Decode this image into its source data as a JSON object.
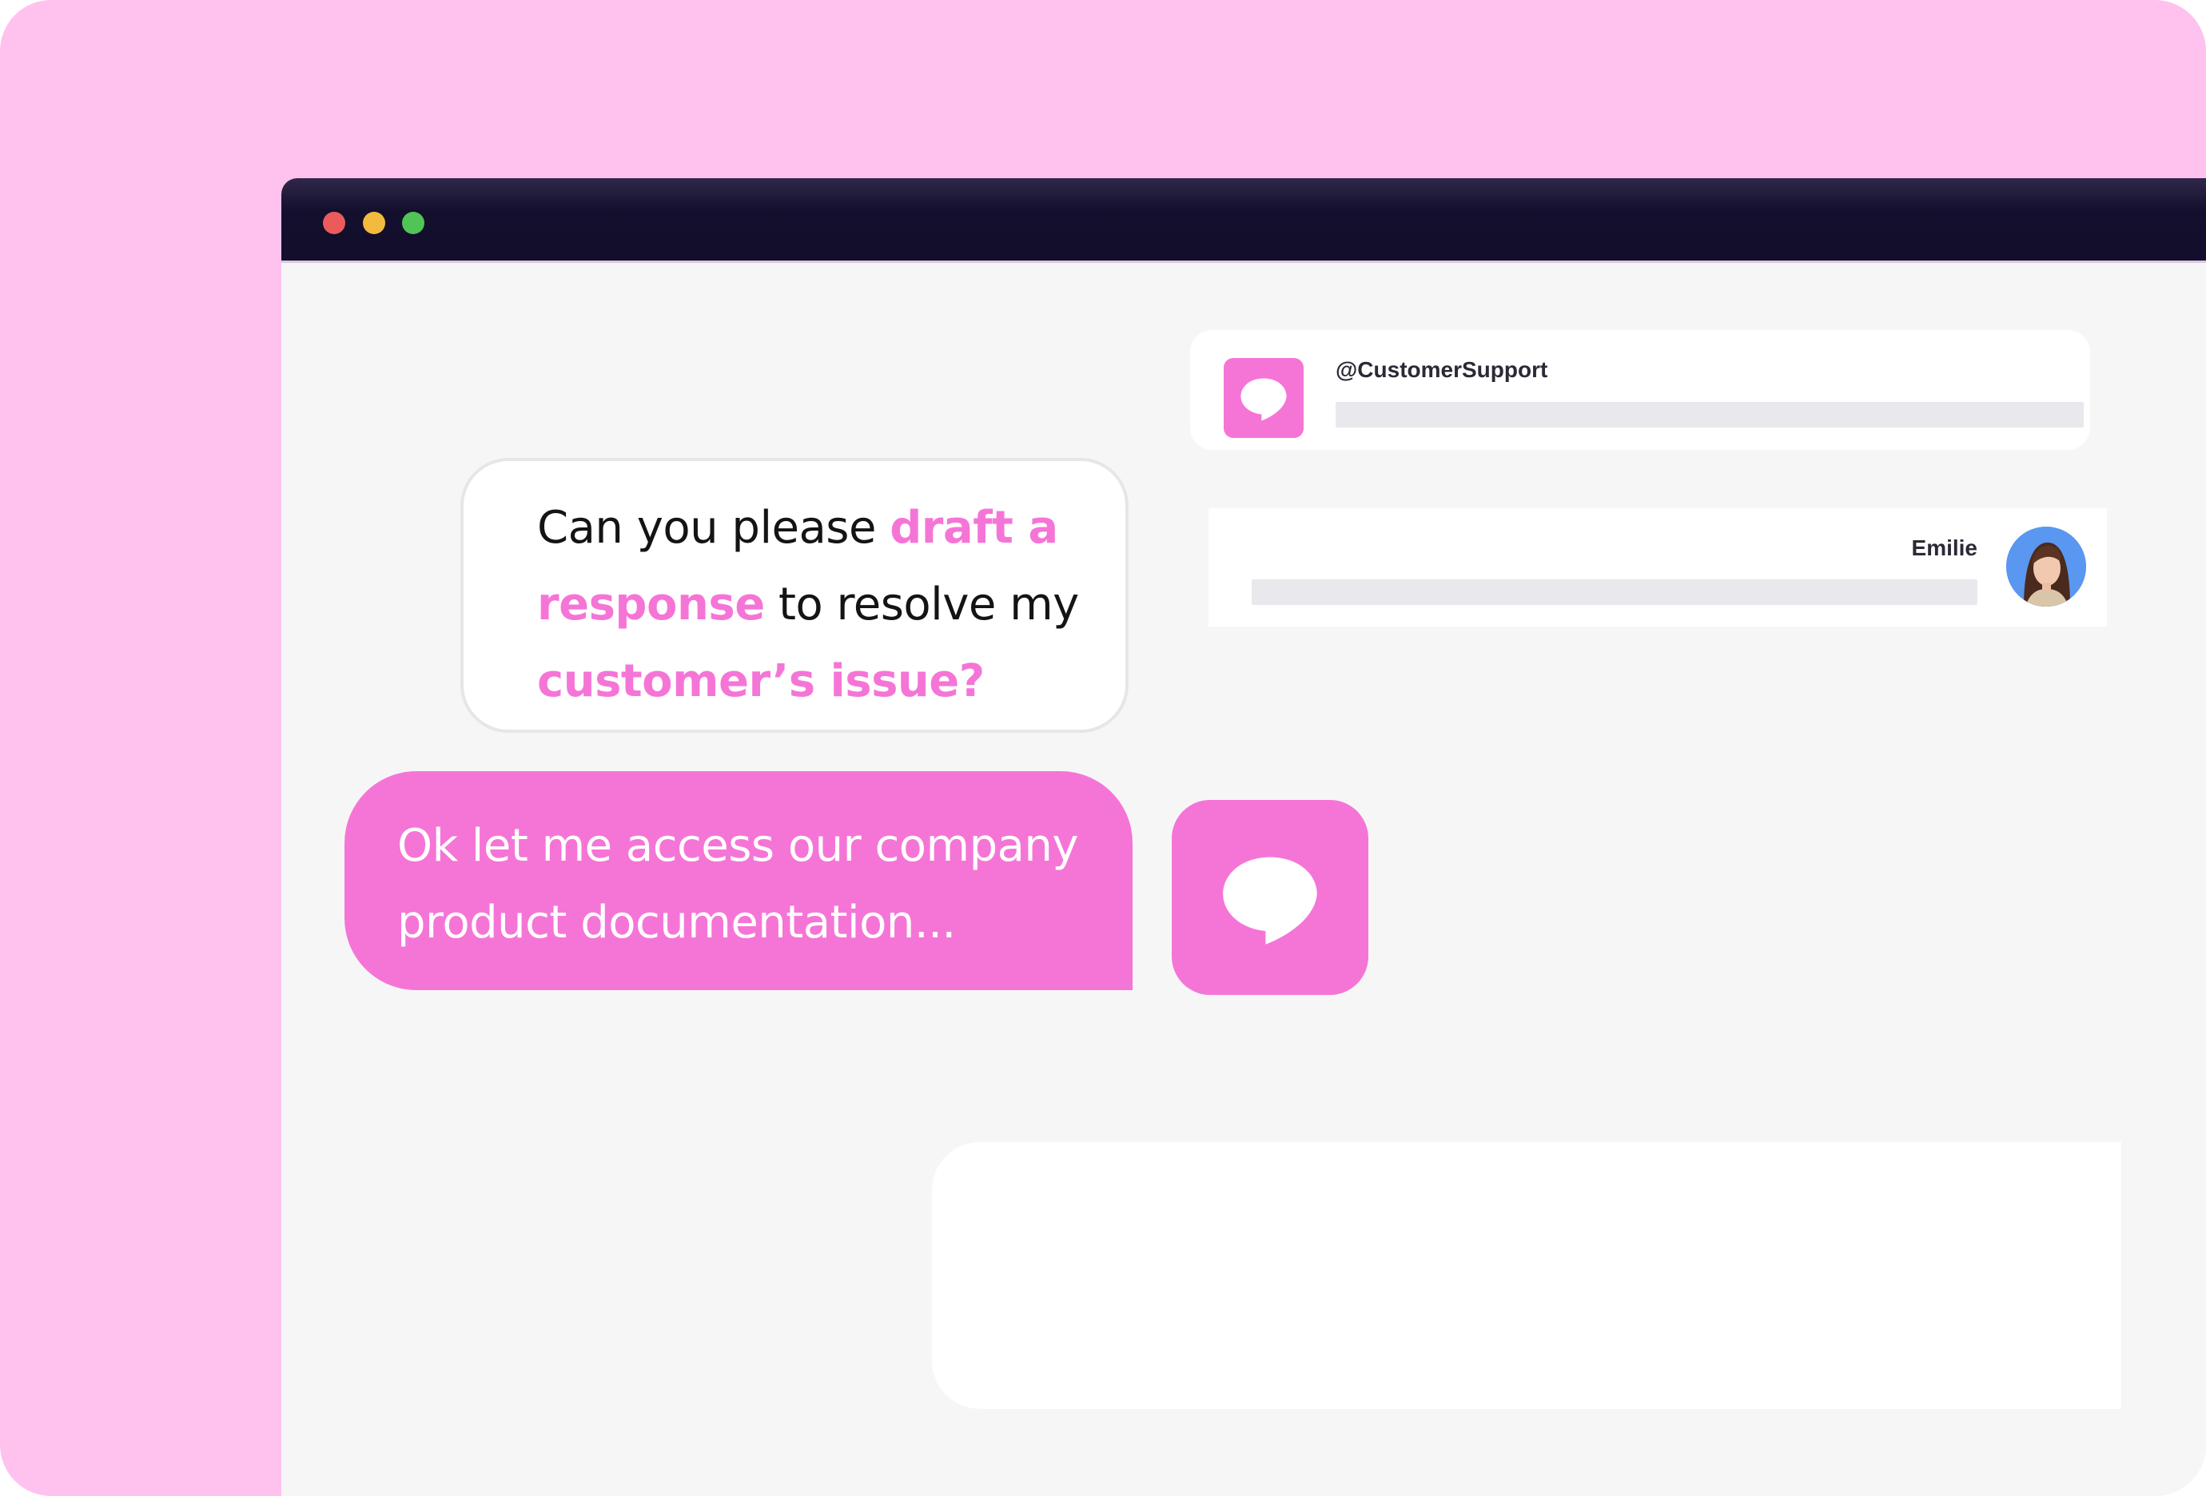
{
  "window": {
    "controls": [
      "close",
      "minimize",
      "maximize"
    ]
  },
  "support_card": {
    "handle": "@CustomerSupport",
    "icon": "chat-bubble-icon"
  },
  "emilie_card": {
    "name": "Emilie",
    "avatar": "user-avatar"
  },
  "user_message": {
    "parts": [
      {
        "text": "Can you please ",
        "highlight": false
      },
      {
        "text": "draft a response",
        "highlight": true
      },
      {
        "text": " to resolve my ",
        "highlight": false
      },
      {
        "text": "customer’s issue?",
        "highlight": true
      }
    ]
  },
  "bot_message": {
    "text": "Ok let me access our company product documentation..."
  },
  "colors": {
    "brand_pink": "#f575d7",
    "background_pink": "#ffc1ee",
    "titlebar": "#120e2b",
    "canvas": "#f6f6f7"
  }
}
